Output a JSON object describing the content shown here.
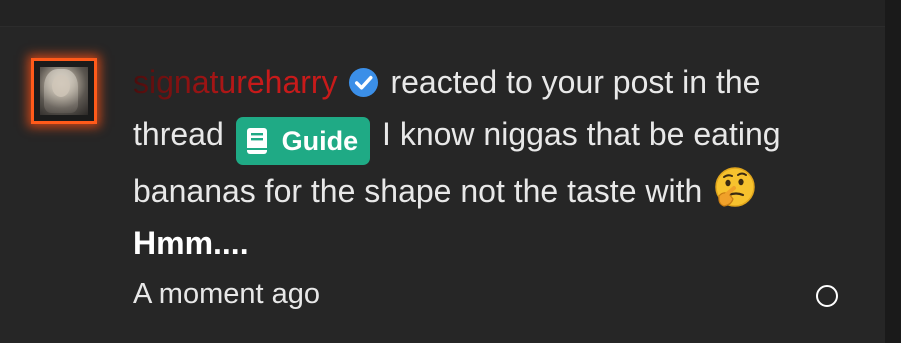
{
  "notification": {
    "username": "signatureharry",
    "verified_icon": "verified-check-icon",
    "action_text": "reacted to your post in the thread",
    "thread_prefix": {
      "icon": "book-icon",
      "label": "Guide",
      "color": "#1faa85"
    },
    "thread_title": "I know niggas that be eating bananas for the shape not the taste with",
    "reaction": {
      "emoji_icon": "thinking-face-icon",
      "label": "Hmm...."
    },
    "timestamp": "A moment ago",
    "read_indicator_icon": "unread-circle-icon"
  },
  "colors": {
    "background": "#262626",
    "username": "#c81a1a",
    "avatar_border": "#ff5a1a",
    "verified": "#3b8fe8",
    "text": "#e8e8e8"
  }
}
